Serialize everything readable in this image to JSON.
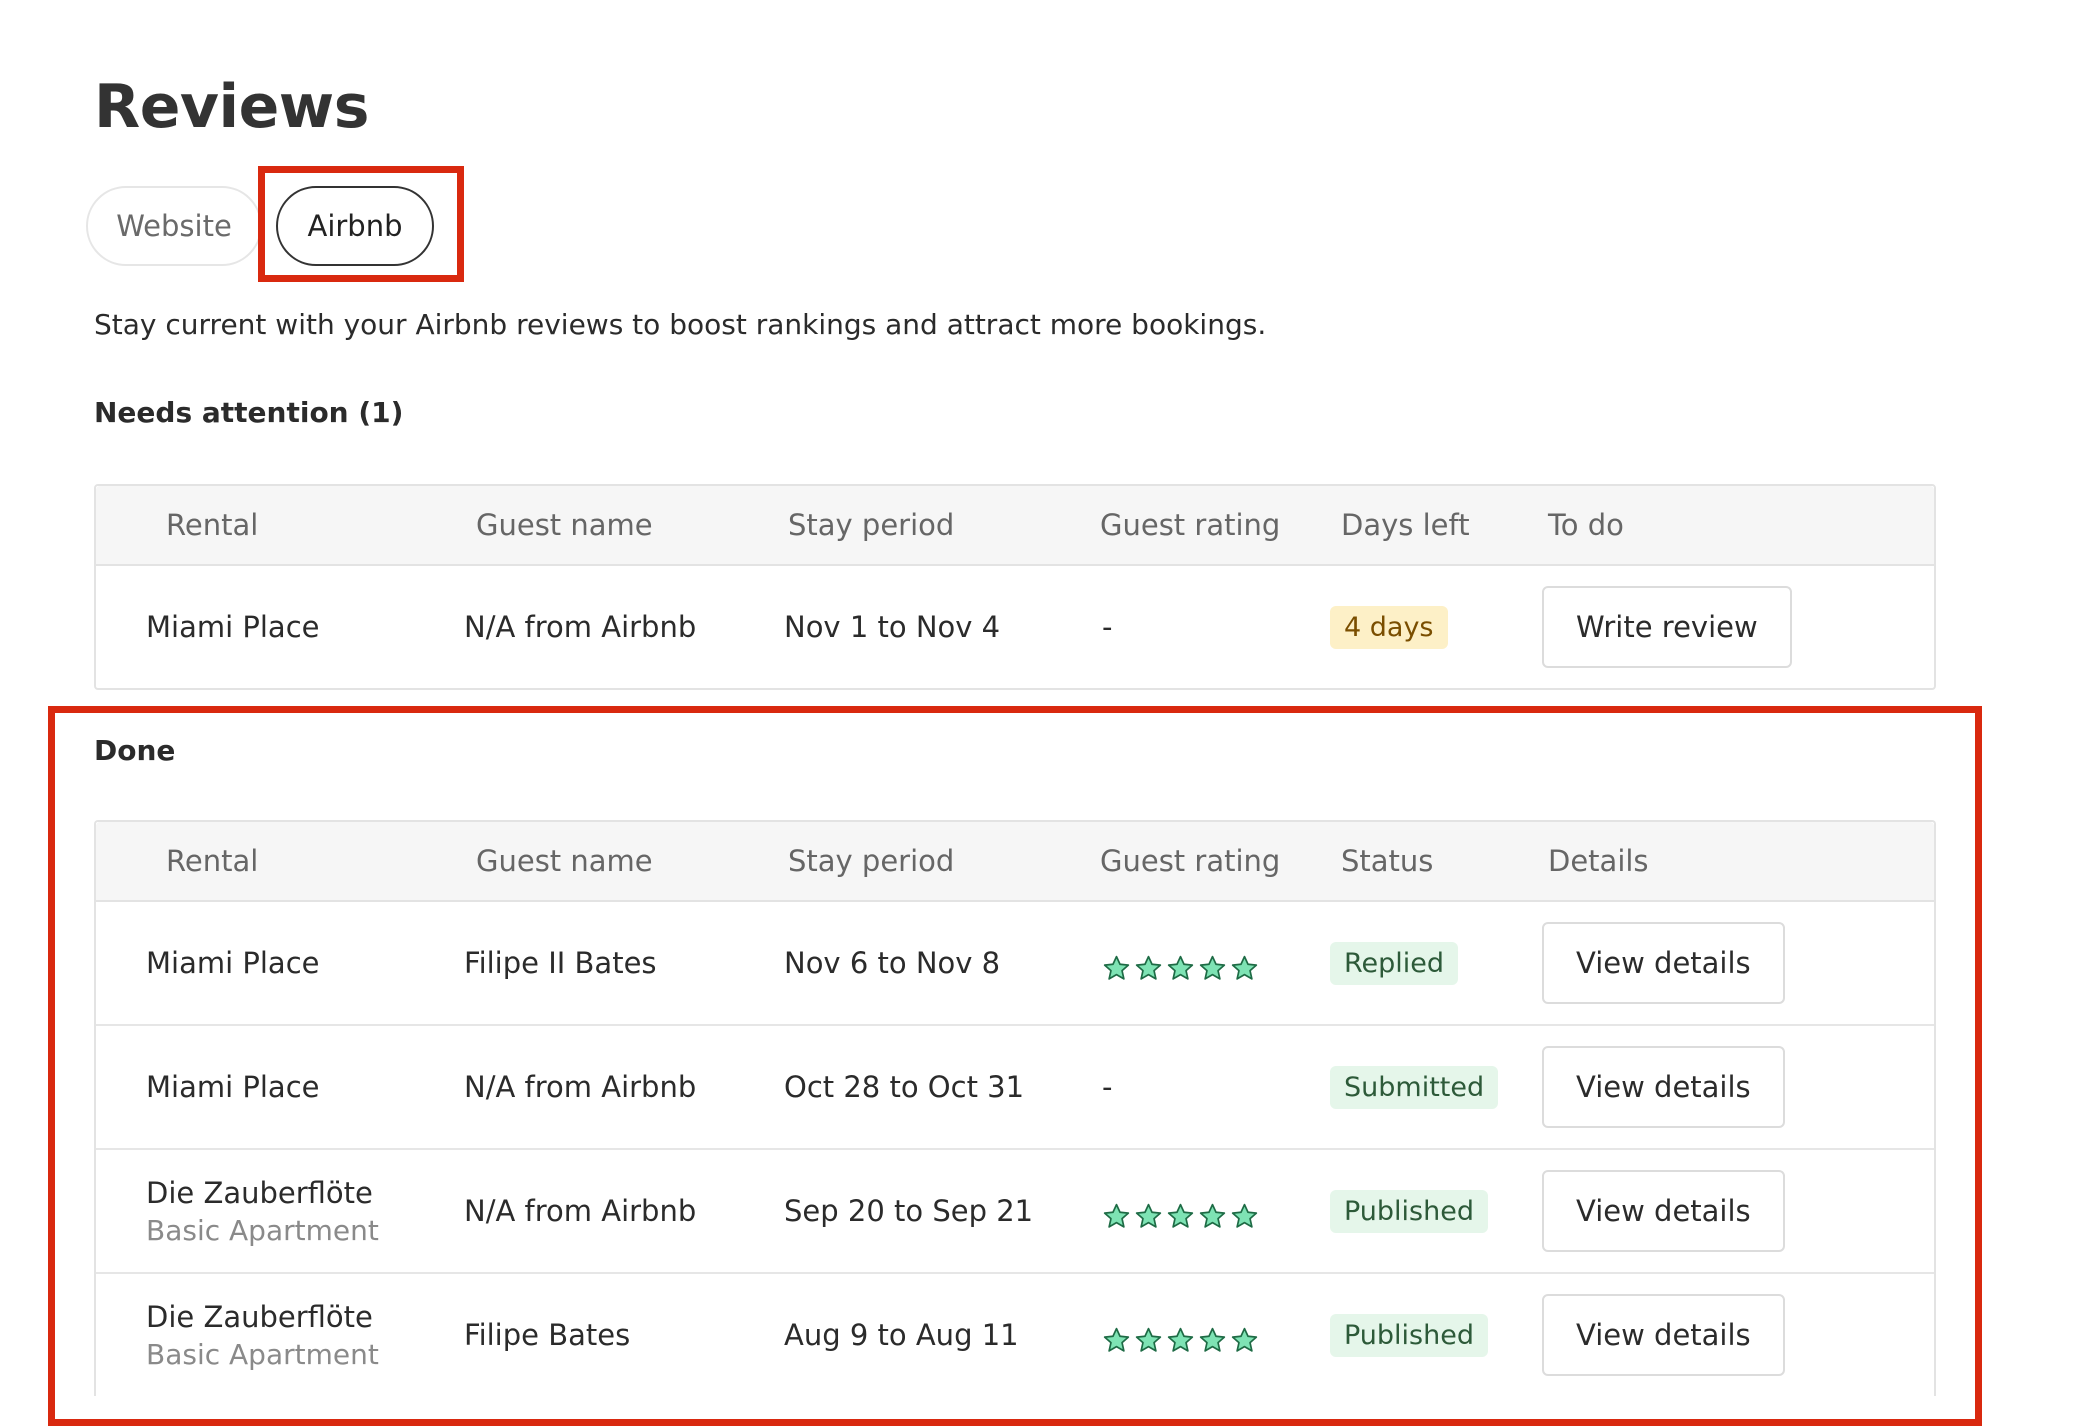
{
  "page": {
    "title": "Reviews",
    "subtitle": "Stay current with your Airbnb reviews to boost rankings and attract more bookings."
  },
  "tabs": [
    {
      "label": "Website",
      "selected": false
    },
    {
      "label": "Airbnb",
      "selected": true
    }
  ],
  "needs_attention": {
    "heading": "Needs attention (1)",
    "columns": [
      "Rental",
      "Guest name",
      "Stay period",
      "Guest rating",
      "Days left",
      "To do"
    ],
    "rows": [
      {
        "rental": "Miami Place",
        "guest": "N/A from Airbnb",
        "stay": "Nov 1 to Nov 4",
        "rating": "-",
        "days_left": "4 days",
        "action": "Write review"
      }
    ]
  },
  "done": {
    "heading": "Done",
    "columns": [
      "Rental",
      "Guest name",
      "Stay period",
      "Guest rating",
      "Status",
      "Details"
    ],
    "rows": [
      {
        "rental": "Miami Place",
        "rental_sub": "",
        "guest": "Filipe II Bates",
        "stay": "Nov 6 to Nov 8",
        "rating_stars": 5,
        "status": "Replied",
        "action": "View details"
      },
      {
        "rental": "Miami Place",
        "rental_sub": "",
        "guest": "N/A from Airbnb",
        "stay": "Oct 28 to Oct 31",
        "rating_text": "-",
        "status": "Submitted",
        "action": "View details"
      },
      {
        "rental": "Die Zauberflöte",
        "rental_sub": "Basic Apartment",
        "guest": "N/A from Airbnb",
        "stay": "Sep 20 to Sep 21",
        "rating_stars": 5,
        "status": "Published",
        "action": "View details"
      },
      {
        "rental": "Die Zauberflöte",
        "rental_sub": "Basic Apartment",
        "guest": "Filipe Bates",
        "stay": "Aug 9 to Aug 11",
        "rating_stars": 5,
        "status": "Published",
        "action": "View details"
      }
    ]
  },
  "colors": {
    "highlight": "#d9290f",
    "star_fill": "#7ee3b4",
    "star_stroke": "#1e6b45"
  }
}
